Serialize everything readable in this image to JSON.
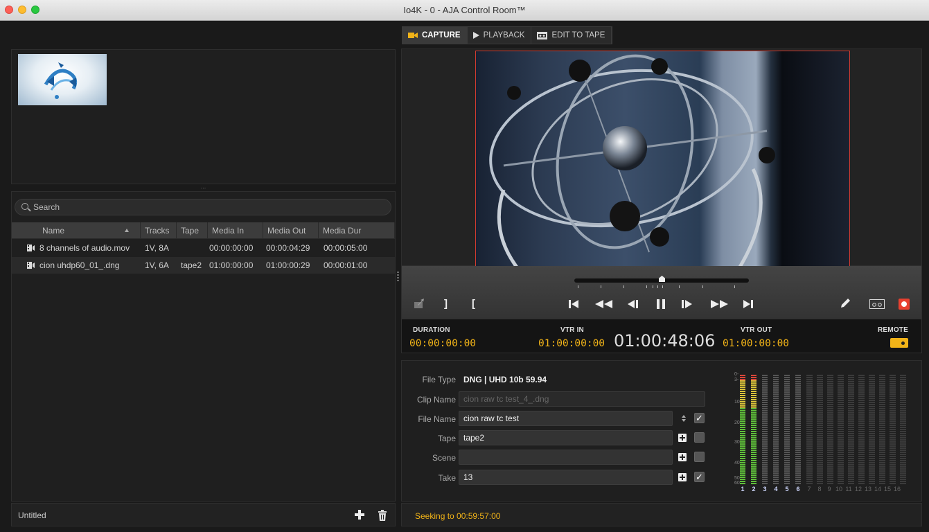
{
  "window": {
    "title": "Io4K - 0 - AJA Control Room™"
  },
  "tabs": [
    {
      "label": "CAPTURE",
      "icon": "camera-icon",
      "active": true
    },
    {
      "label": "PLAYBACK",
      "icon": "play-icon",
      "active": false
    },
    {
      "label": "EDIT TO TAPE",
      "icon": "tape-icon",
      "active": false
    }
  ],
  "library": {
    "search_placeholder": "Search",
    "columns": [
      "Name",
      "Tracks",
      "Tape",
      "Media In",
      "Media Out",
      "Media Dur"
    ],
    "rows": [
      {
        "name": "8 channels of audio.mov",
        "tracks": "1V, 8A",
        "tape": "",
        "media_in": "00:00:00:00",
        "media_out": "00:00:04:29",
        "media_dur": "00:00:05:00"
      },
      {
        "name": "cion uhdp60_01_.dng",
        "tracks": "1V, 6A",
        "tape": "tape2",
        "media_in": "01:00:00:00",
        "media_out": "01:00:00:29",
        "media_dur": "00:00:01:00"
      }
    ],
    "project_name": "Untitled"
  },
  "transport": {
    "mark_out_label": "]",
    "mark_in_label": "["
  },
  "timecode": {
    "duration_label": "DURATION",
    "duration": "00:00:00:00",
    "vtr_in_label": "VTR IN",
    "vtr_in": "01:00:00:00",
    "current": "01:00:48:06",
    "vtr_out_label": "VTR OUT",
    "vtr_out": "01:00:00:00",
    "remote_label": "REMOTE"
  },
  "metadata": {
    "file_type_label": "File Type",
    "file_type": "DNG | UHD 10b 59.94",
    "clip_name_label": "Clip Name",
    "clip_name": "cion raw tc test_4_.dng",
    "file_name_label": "File Name",
    "file_name": "cion raw tc test",
    "tape_label": "Tape",
    "tape": "tape2",
    "scene_label": "Scene",
    "scene": "",
    "take_label": "Take",
    "take": "13",
    "checks": {
      "file_name": true,
      "tape": false,
      "scene": false,
      "take": true
    }
  },
  "audio_meters": {
    "scale": [
      "0-",
      "3-",
      "10-",
      "20-",
      "30-",
      "40-",
      "50-",
      "60-"
    ],
    "channels": [
      "1",
      "2",
      "3",
      "4",
      "5",
      "6",
      "7",
      "8",
      "9",
      "10",
      "11",
      "12",
      "13",
      "14",
      "15",
      "16"
    ],
    "active_channels": 6,
    "colors": {
      "green": "#5fbf3a",
      "yellow": "#d9c23a",
      "red": "#d9463a"
    }
  },
  "status": {
    "message": "Seeking to 00:59:57:00"
  },
  "colors": {
    "accent_yellow": "#f1b318",
    "record_red": "#e8402f",
    "video_border": "#d23b30"
  }
}
